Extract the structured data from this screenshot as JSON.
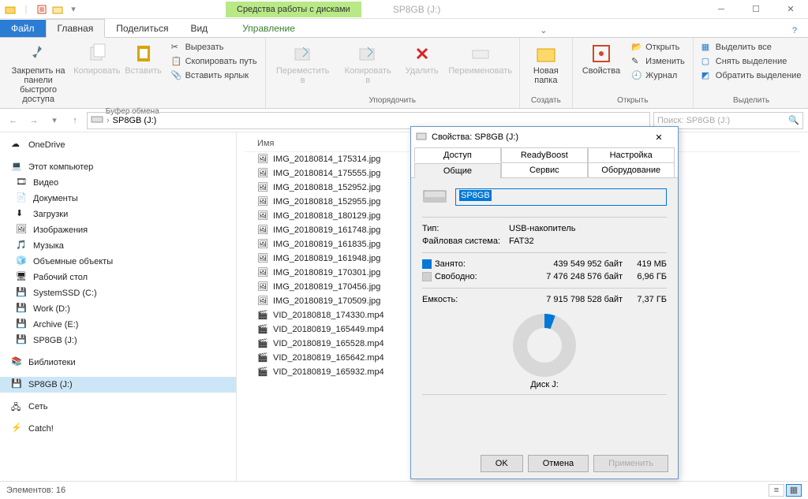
{
  "window": {
    "title": "SP8GB (J:)",
    "ctx_tab": "Средства работы с дисками",
    "ctx_action": "Управление"
  },
  "tabs": {
    "file": "Файл",
    "home": "Главная",
    "share": "Поделиться",
    "view": "Вид"
  },
  "ribbon": {
    "pin": "Закрепить на панели быстрого доступа",
    "copy": "Копировать",
    "paste": "Вставить",
    "cut": "Вырезать",
    "copy_path": "Скопировать путь",
    "paste_shortcut": "Вставить ярлык",
    "move_to": "Переместить в",
    "copy_to": "Копировать в",
    "delete": "Удалить",
    "rename": "Переименовать",
    "new_folder": "Новая папка",
    "properties": "Свойства",
    "open": "Открыть",
    "edit": "Изменить",
    "history": "Журнал",
    "select_all": "Выделить все",
    "select_none": "Снять выделение",
    "invert": "Обратить выделение",
    "g_clipboard": "Буфер обмена",
    "g_organize": "Упорядочить",
    "g_new": "Создать",
    "g_open": "Открыть",
    "g_select": "Выделить"
  },
  "address": {
    "path": "SP8GB (J:)",
    "search_placeholder": "Поиск: SP8GB (J:)"
  },
  "sidebar": {
    "onedrive": "OneDrive",
    "this_pc": "Этот компьютер",
    "videos": "Видео",
    "documents": "Документы",
    "downloads": "Загрузки",
    "pictures": "Изображения",
    "music": "Музыка",
    "objects3d": "Объемные объекты",
    "desktop": "Рабочий стол",
    "drive_c": "SystemSSD (C:)",
    "drive_d": "Work (D:)",
    "drive_e": "Archive (E:)",
    "drive_j": "SP8GB (J:)",
    "libraries": "Библиотеки",
    "drive_j2": "SP8GB (J:)",
    "network": "Сеть",
    "catch": "Catch!"
  },
  "filelist": {
    "col_name": "Имя",
    "files": [
      "IMG_20180814_175314.jpg",
      "IMG_20180814_175555.jpg",
      "IMG_20180818_152952.jpg",
      "IMG_20180818_152955.jpg",
      "IMG_20180818_180129.jpg",
      "IMG_20180819_161748.jpg",
      "IMG_20180819_161835.jpg",
      "IMG_20180819_161948.jpg",
      "IMG_20180819_170301.jpg",
      "IMG_20180819_170456.jpg",
      "IMG_20180819_170509.jpg",
      "VID_20180818_174330.mp4",
      "VID_20180819_165449.mp4",
      "VID_20180819_165528.mp4",
      "VID_20180819_165642.mp4",
      "VID_20180819_165932.mp4"
    ]
  },
  "status": {
    "count": "Элементов: 16"
  },
  "dialog": {
    "title": "Свойства: SP8GB (J:)",
    "tabs_row1": [
      "Доступ",
      "ReadyBoost",
      "Настройка"
    ],
    "tabs_row2": [
      "Общие",
      "Сервис",
      "Оборудование"
    ],
    "input_value": "SP8GB",
    "type_lbl": "Тип:",
    "type_val": "USB-накопитель",
    "fs_lbl": "Файловая система:",
    "fs_val": "FAT32",
    "used_lbl": "Занято:",
    "used_bytes": "439 549 952 байт",
    "used_h": "419 МБ",
    "free_lbl": "Свободно:",
    "free_bytes": "7 476 248 576 байт",
    "free_h": "6,96 ГБ",
    "cap_lbl": "Емкость:",
    "cap_bytes": "7 915 798 528 байт",
    "cap_h": "7,37 ГБ",
    "disk_label": "Диск J:",
    "ok": "OK",
    "cancel": "Отмена",
    "apply": "Применить"
  },
  "chart_data": {
    "type": "pie",
    "title": "Диск J:",
    "series": [
      {
        "name": "Занято",
        "value": 439549952,
        "color": "#0078d7"
      },
      {
        "name": "Свободно",
        "value": 7476248576,
        "color": "#d8d8d8"
      }
    ],
    "total": 7915798528
  }
}
